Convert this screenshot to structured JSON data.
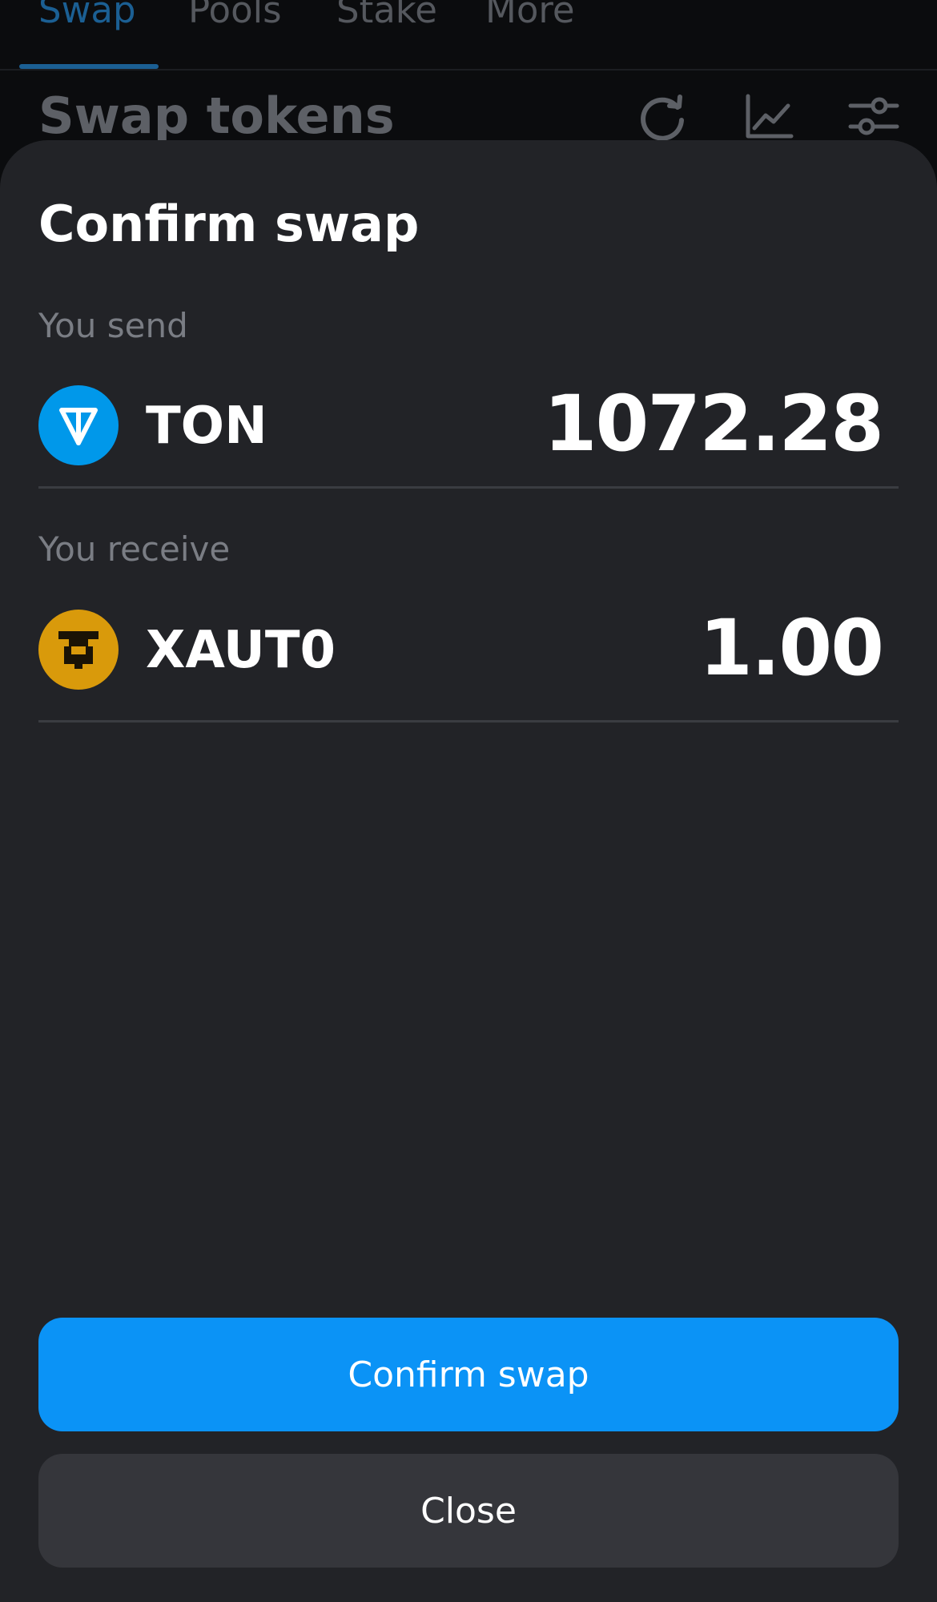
{
  "tabs": [
    {
      "label": "Swap",
      "active": true
    },
    {
      "label": "Pools",
      "active": false
    },
    {
      "label": "Stake",
      "active": false
    },
    {
      "label": "More",
      "active": false
    }
  ],
  "background": {
    "title": "Swap tokens",
    "icons": [
      "refresh-icon",
      "chart-icon",
      "settings-icon"
    ]
  },
  "sheet": {
    "title": "Confirm swap",
    "send": {
      "label": "You send",
      "token": "TON",
      "amount": "1072.28",
      "logo_icon": "ton-logo-icon",
      "logo_color": "#0098ea"
    },
    "receive": {
      "label": "You receive",
      "token": "XAUT0",
      "amount": "1.00",
      "logo_icon": "xaut0-logo-icon",
      "logo_color": "#d99a0b"
    },
    "confirm_label": "Confirm swap",
    "close_label": "Close"
  },
  "colors": {
    "accent": "#0b93f6",
    "sheet_bg": "#222327",
    "secondary_button": "#35363b"
  }
}
